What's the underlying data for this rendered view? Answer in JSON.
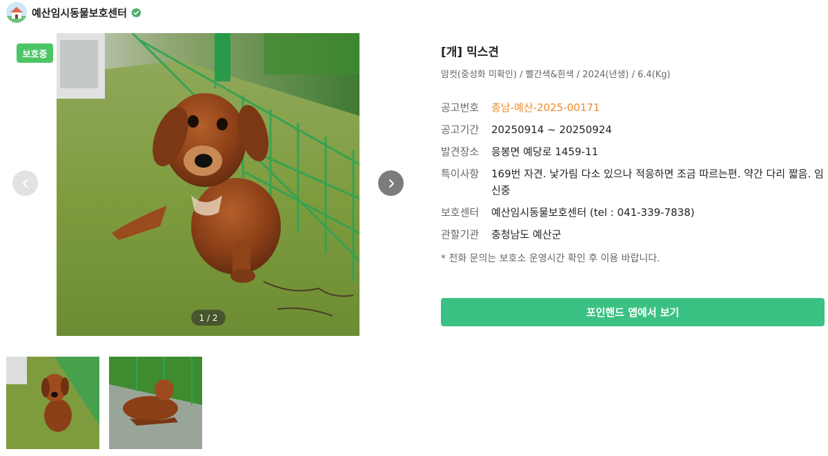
{
  "header": {
    "shelter_name": "예산임시동물보호센터"
  },
  "photo": {
    "badge": "보호중",
    "counter": "1 / 2"
  },
  "animal": {
    "title": "[개] 믹스견",
    "subtitle": "암컷(중성화 미확인) / 빨간색&흰색 / 2024(년생) / 6.4(Kg)"
  },
  "details": [
    {
      "label": "공고번호",
      "value": "충남-예산-2025-00171"
    },
    {
      "label": "공고기간",
      "value": "20250914 ~ 20250924"
    },
    {
      "label": "발견장소",
      "value": "응봉면 예당로 1459-11"
    },
    {
      "label": "특이사항",
      "value": "169번 자견. 낯가림 다소 있으나 적응하면 조금 따르는편. 약간 다리 짧음. 임신중"
    },
    {
      "label": "보호센터",
      "value": "예산임시동물보호센터 (tel : 041-339-7838)"
    },
    {
      "label": "관할기관",
      "value": "충청남도 예산군"
    }
  ],
  "notice": "* 전화 문의는 보호소 운영시간 확인 후 이용 바랍니다.",
  "cta_label": "포인핸드 앱에서 보기",
  "colors": {
    "badge": "#4cc567",
    "cta": "#3cc185",
    "notice_number": "#f08a2c"
  },
  "icons": [
    "shelter-house-icon",
    "verified-check-icon",
    "chevron-left-icon",
    "chevron-right-icon"
  ]
}
